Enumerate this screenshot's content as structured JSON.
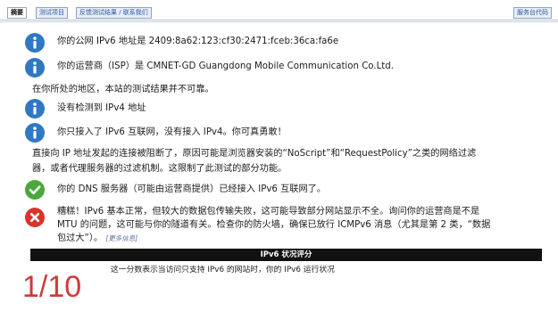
{
  "tabs": [
    {
      "label": "摘要",
      "active": true
    },
    {
      "label": "测试项目",
      "active": false
    },
    {
      "label": "反馈测试结果 / 联系我们",
      "active": false
    },
    {
      "label": "服务台代码",
      "active": false
    }
  ],
  "results": {
    "public_ipv6": "你的公网 IPv6 地址是 2409:8a62:123:cf30:2471:fceb:36ca:fa6e",
    "isp": "你的运营商（ISP）是 CMNET-GD Guangdong Mobile Communication Co.Ltd.",
    "region_note": "在你所处的地区，本站的测试结果并不可靠。",
    "no_ipv4": "没有检测到 IPv4 地址",
    "ipv6_only": "你只接入了 IPv6 互联网，没有接入 IPv4。你可真勇敢！",
    "blocked_line1": "直接向 IP 地址发起的连接被阻断了，原因可能是浏览器安装的“NoScript”和“RequestPolicy”之类的网络过滤",
    "blocked_line2": "器，或者代理服务器的过滤机制。这限制了此测试的部分功能。",
    "dns": "你的 DNS 服务器（可能由运营商提供）已经接入 IPv6 互联网了。",
    "error_line1": "糟糕！IPv6 基本正常，但较大的数据包传输失败，这可能导致部分网站显示不全。询问你的运营商是不是",
    "error_line2": "MTU 的问题，这可能与你的隧道有关。检查你的防火墙，确保已放行 ICMPv6 消息（尤其是第 2 类，“数据",
    "error_line3": "包过大”）。",
    "more_info": "[更多信息]"
  },
  "score": {
    "heading": "IPv6 状况评分",
    "value": "1/10",
    "description": "这一分数表示当访问只支持 IPv6 的网站时，你的 IPv6 运行状况"
  },
  "colors": {
    "info_icon": "#2f78c4",
    "success_icon": "#4aa83c",
    "error_icon": "#d9342b",
    "score_value": "#cf3a3a",
    "score_head_bg": "#111111"
  },
  "icons": {
    "info": "info-circle-icon",
    "success": "check-circle-icon",
    "error": "x-circle-icon"
  }
}
